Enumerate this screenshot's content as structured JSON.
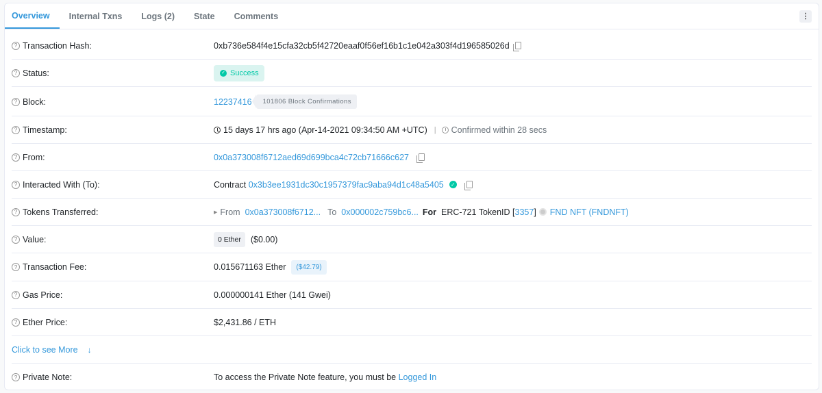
{
  "tabs": [
    {
      "label": "Overview",
      "active": true
    },
    {
      "label": "Internal Txns"
    },
    {
      "label": "Logs (2)"
    },
    {
      "label": "State"
    },
    {
      "label": "Comments"
    }
  ],
  "more_menu_icon": "vertical-ellipsis-icon",
  "rows": {
    "tx_hash": {
      "label": "Transaction Hash:",
      "value": "0xb736e584f4e15cfa32cb5f42720eaaf0f56ef16b1c1e042a303f4d196585026d"
    },
    "status": {
      "label": "Status:",
      "value": "Success"
    },
    "block": {
      "label": "Block:",
      "value": "12237416",
      "confirmations": "101806 Block Confirmations"
    },
    "timestamp": {
      "label": "Timestamp:",
      "value": "15 days 17 hrs ago (Apr-14-2021 09:34:50 AM +UTC)",
      "separator": "|",
      "confirmed": "Confirmed within 28 secs"
    },
    "from": {
      "label": "From:",
      "value": "0x0a373008f6712aed69d699bca4c72cb71666c627"
    },
    "to": {
      "label": "Interacted With (To):",
      "prefix": "Contract",
      "value": "0x3b3ee1931dc30c1957379fac9aba94d1c48a5405"
    },
    "tokens": {
      "label": "Tokens Transferred:",
      "from_label": "From",
      "from_value": "0x0a373008f6712...",
      "to_label": "To",
      "to_value": "0x000002c759bc6...",
      "for_label": "For",
      "standard": "ERC-721 TokenID [",
      "token_id": "3357",
      "close_bracket": "]",
      "token_name": "FND NFT (FNDNFT)"
    },
    "value": {
      "label": "Value:",
      "ether": "0 Ether",
      "usd": "($0.00)"
    },
    "fee": {
      "label": "Transaction Fee:",
      "value": "0.015671163 Ether",
      "usd": "($42.79)"
    },
    "gas_price": {
      "label": "Gas Price:",
      "value": "0.000000141 Ether (141 Gwei)"
    },
    "ether_price": {
      "label": "Ether Price:",
      "value": "$2,431.86 / ETH"
    },
    "see_more": {
      "label": "Click to see More",
      "icon": "↓"
    },
    "private_note": {
      "label": "Private Note:",
      "value": "To access the Private Note feature, you must be",
      "link": "Logged In"
    }
  },
  "colors": {
    "accent": "#3498db",
    "success": "#00c9a7"
  }
}
